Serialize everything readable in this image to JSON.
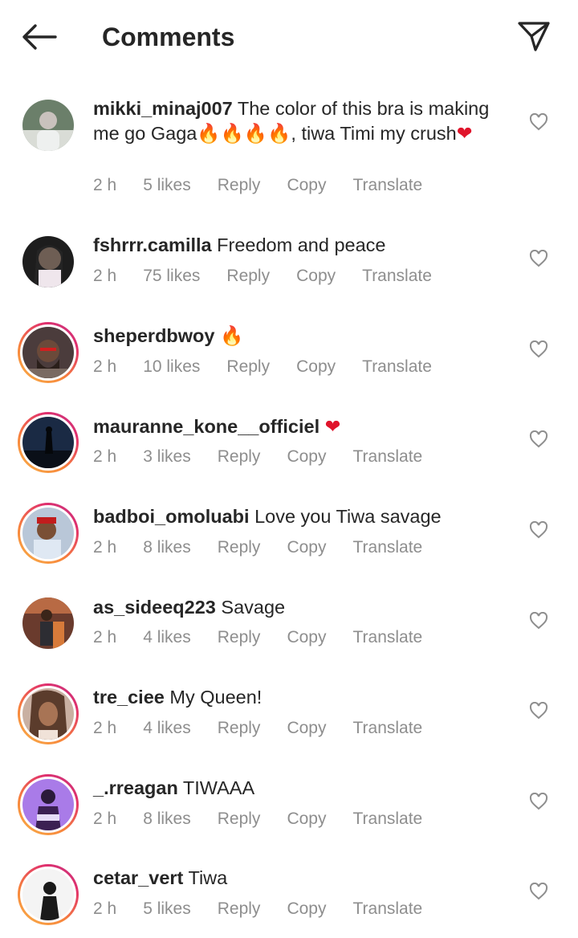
{
  "header": {
    "title": "Comments"
  },
  "colors": {
    "text": "#262626",
    "meta": "#8e8e8e",
    "story_ring_start": "#f9b34a",
    "story_ring_end": "#c13584"
  },
  "actions": {
    "reply": "Reply",
    "copy": "Copy",
    "translate": "Translate"
  },
  "comments": [
    {
      "username": "mikki_minaj007",
      "text": "The color of this bra is making me go Gaga",
      "text_tail": ", tiwa Timi my crush",
      "emojis": [
        "fire",
        "fire",
        "fire",
        "fire",
        "red-heart"
      ],
      "time": "2 h",
      "likes": "5 likes",
      "story_ring": false
    },
    {
      "username": "fshrrr.camilla",
      "text": "Freedom and peace",
      "time": "2 h",
      "likes": "75 likes",
      "story_ring": false
    },
    {
      "username": "sheperdbwoy",
      "text": "",
      "emojis": [
        "fire"
      ],
      "time": "2 h",
      "likes": "10 likes",
      "story_ring": true
    },
    {
      "username": "mauranne_kone__officiel",
      "text": "",
      "emojis": [
        "red-heart"
      ],
      "time": "2 h",
      "likes": "3 likes",
      "story_ring": true
    },
    {
      "username": "badboi_omoluabi",
      "text": "Love you Tiwa savage",
      "time": "2 h",
      "likes": "8 likes",
      "story_ring": true
    },
    {
      "username": "as_sideeq223",
      "text": "Savage",
      "time": "2 h",
      "likes": "4 likes",
      "story_ring": false
    },
    {
      "username": "tre_ciee",
      "text": "My Queen!",
      "time": "2 h",
      "likes": "4 likes",
      "story_ring": true
    },
    {
      "username": "_.rreagan",
      "text": "TIWAAA",
      "time": "2 h",
      "likes": "8 likes",
      "story_ring": true
    },
    {
      "username": "cetar_vert",
      "text": "Tiwa",
      "time": "2 h",
      "likes": "5 likes",
      "story_ring": true
    }
  ]
}
